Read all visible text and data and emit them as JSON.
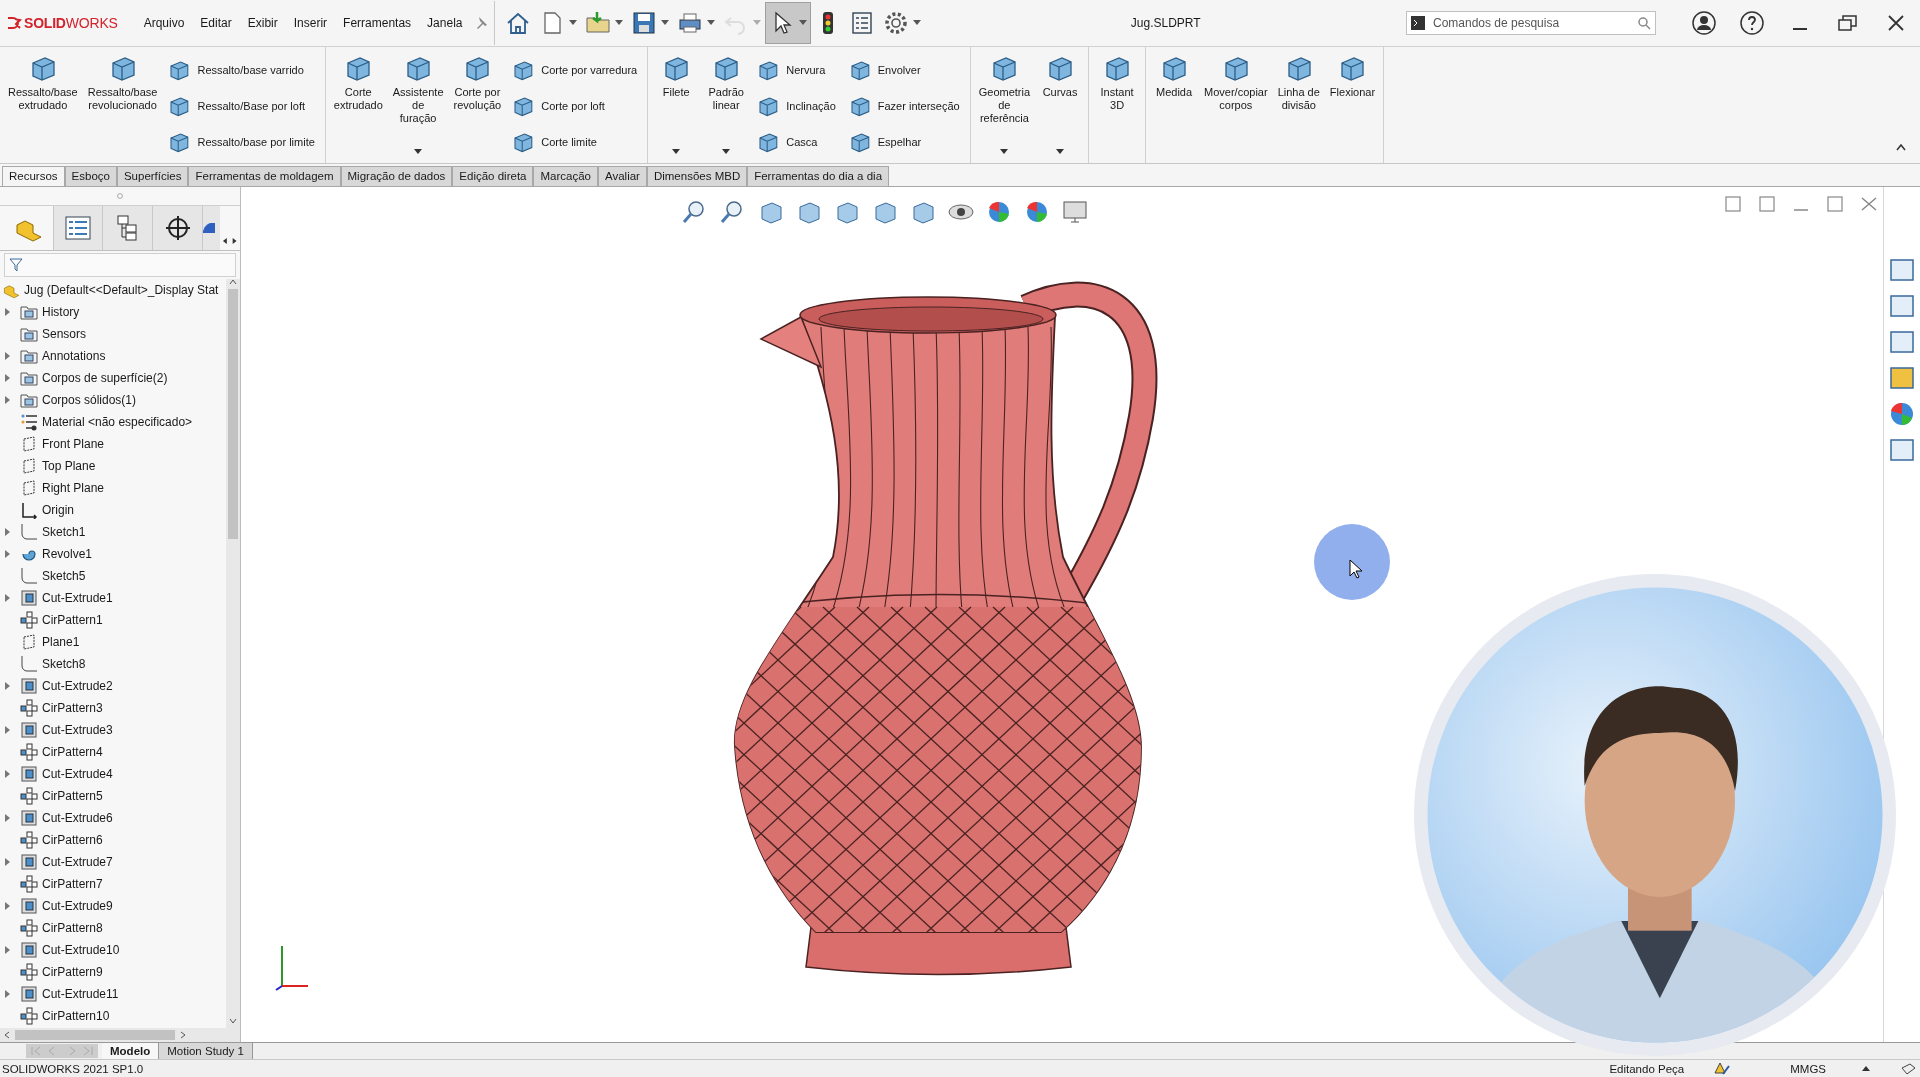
{
  "app": {
    "logo": "**SOLID**WORKS",
    "menu": [
      "Arquivo",
      "Editar",
      "Exibir",
      "Inserir",
      "Ferramentas",
      "Janela"
    ],
    "title": "Jug.SLDPRT",
    "search": {
      "placeholder": "Comandos de pesquisa"
    }
  },
  "quick_access": [
    {
      "kind": "home",
      "dropdown": false,
      "disabled": false,
      "selected": false
    },
    {
      "kind": "new",
      "dropdown": true,
      "disabled": false,
      "selected": false
    },
    {
      "kind": "open",
      "dropdown": true,
      "disabled": false,
      "selected": false
    },
    {
      "kind": "save",
      "dropdown": true,
      "disabled": false,
      "selected": false
    },
    {
      "kind": "print",
      "dropdown": true,
      "disabled": false,
      "selected": false
    },
    {
      "kind": "undo",
      "dropdown": true,
      "disabled": true,
      "selected": false
    },
    {
      "kind": "select",
      "dropdown": true,
      "disabled": false,
      "selected": true
    },
    {
      "kind": "rebuild",
      "dropdown": false,
      "disabled": false,
      "selected": false
    },
    {
      "kind": "properties",
      "dropdown": false,
      "disabled": false,
      "selected": false
    },
    {
      "kind": "options",
      "dropdown": true,
      "disabled": false,
      "selected": false
    }
  ],
  "ribbon": [
    {
      "items": [
        {
          "kind": "large",
          "label": "Ressalto/base\nextrudado",
          "dropdown": false
        },
        {
          "kind": "large",
          "label": "Ressalto/base\nrevolucionado",
          "dropdown": false
        },
        {
          "kind": "stack",
          "items": [
            "Ressalto/base varrido",
            "Ressalto/Base por loft",
            "Ressalto/base por limite"
          ]
        }
      ]
    },
    {
      "items": [
        {
          "kind": "large",
          "label": "Corte\nextrudado",
          "dropdown": false
        },
        {
          "kind": "large",
          "label": "Assistente\nde\nfuração",
          "dropdown": true
        },
        {
          "kind": "large",
          "label": "Corte por\nrevolução",
          "dropdown": false
        },
        {
          "kind": "stack",
          "items": [
            "Corte por varredura",
            "Corte por loft",
            "Corte limite"
          ]
        }
      ]
    },
    {
      "items": [
        {
          "kind": "large",
          "label": "Filete",
          "dropdown": true
        },
        {
          "kind": "large",
          "label": "Padrão\nlinear",
          "dropdown": true
        },
        {
          "kind": "stack",
          "items": [
            "Nervura",
            "Inclinação",
            "Casca"
          ]
        },
        {
          "kind": "stack",
          "items": [
            "Envolver",
            "Fazer interseção",
            "Espelhar"
          ]
        }
      ]
    },
    {
      "items": [
        {
          "kind": "large",
          "label": "Geometria\nde\nreferência",
          "dropdown": true
        },
        {
          "kind": "large",
          "label": "Curvas",
          "dropdown": true
        }
      ]
    },
    {
      "items": [
        {
          "kind": "large",
          "label": "Instant\n3D",
          "dropdown": false
        }
      ]
    },
    {
      "items": [
        {
          "kind": "large",
          "label": "Medida",
          "dropdown": false
        },
        {
          "kind": "large",
          "label": "Mover/copiar\ncorpos",
          "dropdown": false
        },
        {
          "kind": "large",
          "label": "Linha de\ndivisão",
          "dropdown": false
        },
        {
          "kind": "large",
          "label": "Flexionar",
          "dropdown": false
        }
      ]
    }
  ],
  "tabs": [
    {
      "label": "Recursos",
      "selected": true
    },
    {
      "label": "Esboço",
      "selected": false
    },
    {
      "label": "Superfícies",
      "selected": false
    },
    {
      "label": "Ferramentas de moldagem",
      "selected": false
    },
    {
      "label": "Migração de dados",
      "selected": false
    },
    {
      "label": "Edição direta",
      "selected": false
    },
    {
      "label": "Marcação",
      "selected": false
    },
    {
      "label": "Avaliar",
      "selected": false
    },
    {
      "label": "Dimensões MBD",
      "selected": false
    },
    {
      "label": "Ferramentas do dia a dia",
      "selected": false
    }
  ],
  "tree": {
    "root": "Jug  (Default<<Default>_Display Stat",
    "items": [
      {
        "label": "History",
        "kind": "folder",
        "expandable": true
      },
      {
        "label": "Sensors",
        "kind": "folder",
        "expandable": false
      },
      {
        "label": "Annotations",
        "kind": "folder",
        "expandable": true
      },
      {
        "label": "Corpos de superfície(2)",
        "kind": "folder",
        "expandable": true
      },
      {
        "label": "Corpos sólidos(1)",
        "kind": "folder",
        "expandable": true
      },
      {
        "label": "Material <não especificado>",
        "kind": "material",
        "expandable": false
      },
      {
        "label": "Front Plane",
        "kind": "plane",
        "expandable": false
      },
      {
        "label": "Top Plane",
        "kind": "plane",
        "expandable": false
      },
      {
        "label": "Right Plane",
        "kind": "plane",
        "expandable": false
      },
      {
        "label": "Origin",
        "kind": "origin",
        "expandable": false
      },
      {
        "label": "Sketch1",
        "kind": "sketch",
        "expandable": true
      },
      {
        "label": "Revolve1",
        "kind": "revolve",
        "expandable": true
      },
      {
        "label": "Sketch5",
        "kind": "sketch",
        "expandable": false
      },
      {
        "label": "Cut-Extrude1",
        "kind": "cut",
        "expandable": true
      },
      {
        "label": "CirPattern1",
        "kind": "pattern",
        "expandable": false
      },
      {
        "label": "Plane1",
        "kind": "plane",
        "expandable": false
      },
      {
        "label": "Sketch8",
        "kind": "sketch",
        "expandable": false
      },
      {
        "label": "Cut-Extrude2",
        "kind": "cut",
        "expandable": true
      },
      {
        "label": "CirPattern3",
        "kind": "pattern",
        "expandable": false
      },
      {
        "label": "Cut-Extrude3",
        "kind": "cut",
        "expandable": true
      },
      {
        "label": "CirPattern4",
        "kind": "pattern",
        "expandable": false
      },
      {
        "label": "Cut-Extrude4",
        "kind": "cut",
        "expandable": true
      },
      {
        "label": "CirPattern5",
        "kind": "pattern",
        "expandable": false
      },
      {
        "label": "Cut-Extrude6",
        "kind": "cut",
        "expandable": true
      },
      {
        "label": "CirPattern6",
        "kind": "pattern",
        "expandable": false
      },
      {
        "label": "Cut-Extrude7",
        "kind": "cut",
        "expandable": true
      },
      {
        "label": "CirPattern7",
        "kind": "pattern",
        "expandable": false
      },
      {
        "label": "Cut-Extrude9",
        "kind": "cut",
        "expandable": true
      },
      {
        "label": "CirPattern8",
        "kind": "pattern",
        "expandable": false
      },
      {
        "label": "Cut-Extrude10",
        "kind": "cut",
        "expandable": true
      },
      {
        "label": "CirPattern9",
        "kind": "pattern",
        "expandable": false
      },
      {
        "label": "Cut-Extrude11",
        "kind": "cut",
        "expandable": true
      },
      {
        "label": "CirPattern10",
        "kind": "pattern",
        "expandable": false
      }
    ]
  },
  "bottom_tabs": [
    {
      "label": "Modelo",
      "selected": true
    },
    {
      "label": "Motion Study 1",
      "selected": false
    }
  ],
  "status_bar": {
    "version": "SOLIDWORKS 2021 SP1.0",
    "mode": "Editando Peça",
    "units": "MMGS"
  }
}
